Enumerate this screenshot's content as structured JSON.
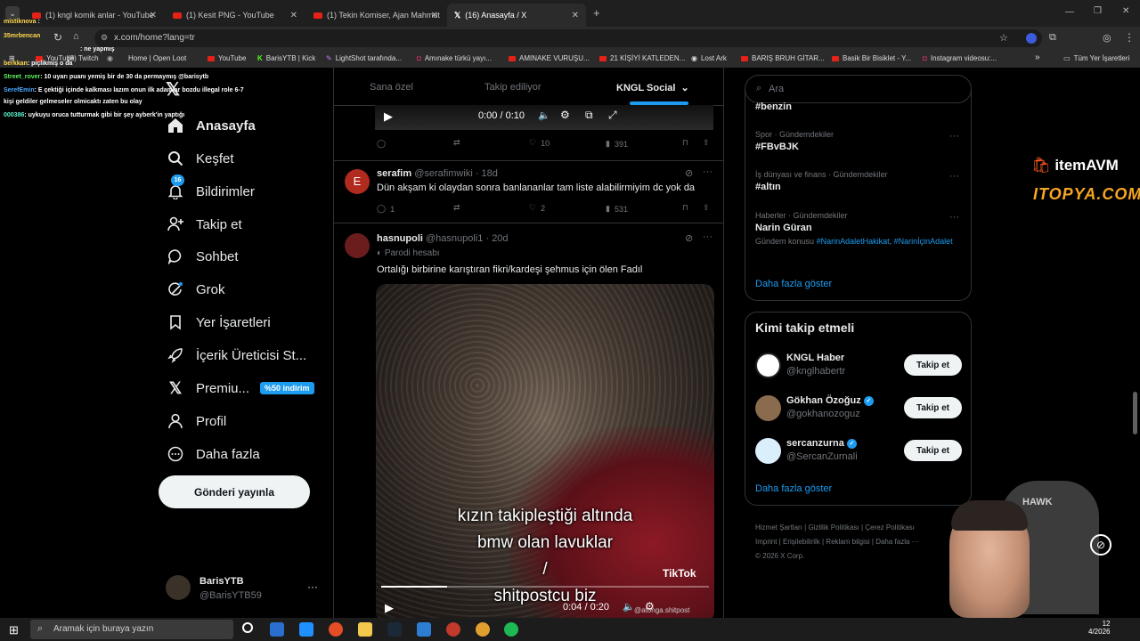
{
  "browser": {
    "tabs": [
      {
        "label": "(1) kngl komik anlar - YouTube"
      },
      {
        "label": "(1) Kesit PNG - YouTube"
      },
      {
        "label": "(1) Tekin Komiser, Ajan Mahmut"
      },
      {
        "label": "(16) Anasayfa / X"
      }
    ],
    "new_tab": "+",
    "url": "x.com/home?lang=tr",
    "bookmarks": [
      "YouTube",
      "(8) Twitch",
      "Home | Open Loot",
      "YouTube",
      "BarisYTB | Kick",
      "LightShot tarafında...",
      "Amınake türkü yayı...",
      "AMINAKE VURUŞU...",
      "21 KİŞİYİ KATLEDEN...",
      "Lost Ark",
      "BARIŞ BRUH GİTAR...",
      "Basik Bir Bisiklet - Y...",
      "Instagram videosu:..."
    ],
    "bookmarks_more": "»",
    "all_bookmarks": "Tüm Yer İşaretleri"
  },
  "nav": {
    "items": [
      {
        "label": "Anasayfa",
        "icon": "home-icon"
      },
      {
        "label": "Keşfet",
        "icon": "search-icon"
      },
      {
        "label": "Bildirimler",
        "icon": "bell-icon",
        "badge": "16"
      },
      {
        "label": "Takip et",
        "icon": "add-person-icon"
      },
      {
        "label": "Sohbet",
        "icon": "chat-icon"
      },
      {
        "label": "Grok",
        "icon": "grok-icon"
      },
      {
        "label": "Yer İşaretleri",
        "icon": "bookmark-icon"
      },
      {
        "label": "İçerik Üreticisi St...",
        "icon": "rocket-icon"
      },
      {
        "label": "Premiu...",
        "icon": "x-logo-icon",
        "badge": "%50 indirim"
      },
      {
        "label": "Profil",
        "icon": "person-icon"
      },
      {
        "label": "Daha fazla",
        "icon": "more-circle-icon"
      }
    ],
    "post_button": "Gönderi yayınla",
    "account": {
      "name": "BarisYTB",
      "handle": "@BarisYTB59",
      "more": "···"
    }
  },
  "feed": {
    "tabs": [
      "Sana özel",
      "Takip ediliyor",
      "KNGL Social"
    ],
    "top_video": {
      "time": "0:00 / 0:10"
    },
    "top_actions": {
      "views": "391",
      "likes": "10"
    },
    "posts": [
      {
        "avatar_letter": "E",
        "name": "serafim",
        "handle": "@serafimwiki",
        "time": "· 18d",
        "text": "Dün akşam ki olaydan sonra banlananlar tam liste alabilirmiyim dc yok da",
        "replies": "1",
        "retweets": "",
        "likes": "2",
        "views": "531"
      },
      {
        "name": "hasnupoli",
        "handle": "@hasnupoli1",
        "time": "· 20d",
        "parody": "Parodi hesabı",
        "text": "Ortalığı birbirine karıştıran fikri/kardeşi şehmus için ölen Fadıl",
        "video_caption": [
          "kızın takipleştiği altında",
          "bmw olan lavuklar",
          "/",
          "shitpostcu biz"
        ],
        "video_time": "0:04 / 0:20",
        "watermark": "TikTok",
        "watermark_handle": "@atonga.shitpost"
      }
    ]
  },
  "sidebar": {
    "search_placeholder": "Ara",
    "trends": [
      {
        "category": "",
        "name": "#benzin"
      },
      {
        "category": "Spor · Gündemdekiler",
        "name": "#FBvBJK"
      },
      {
        "category": "İş dünyası ve finans · Gündemdekiler",
        "name": "#altın"
      },
      {
        "category": "Haberler · Gündemdekiler",
        "name": "Narin Güran",
        "topic_prefix": "Gündem konusu",
        "topics": "#NarinAdaletHakikat, #NarinİçinAdalet"
      }
    ],
    "show_more": "Daha fazla göster",
    "who_to_follow_title": "Kimi takip etmeli",
    "who_to_follow": [
      {
        "name": "KNGL Haber",
        "handle": "@knglhabertr",
        "verified": false
      },
      {
        "name": "Gökhan Özoğuz",
        "handle": "@gokhanozoguz",
        "verified": true
      },
      {
        "name": "sercanzurna",
        "handle": "@SercanZurnali",
        "verified": true
      }
    ],
    "follow_label": "Takip et",
    "show_more_2": "Daha fazla göster",
    "footer": [
      "Hizmet Şartları",
      "Gizlilik Politikası",
      "Çerez Politikası",
      "Imprint",
      "Erişilebilirlik",
      "Reklam bilgisi",
      "Daha fazla ···",
      "© 2026 X Corp."
    ]
  },
  "stream_overlay": {
    "chat": [
      {
        "user": "mistiknova",
        "msg": ""
      },
      {
        "user": "35mrbencan",
        "msg": ""
      },
      {
        "user": "",
        "msg": ": ne yapmış"
      },
      {
        "user": "berkkan",
        "msg": ": piçlikmiş o da"
      },
      {
        "user": "Street_rover",
        "msg": ": 10 uyarı puanı yemiş bir de 30 da permaymış @barisytb"
      },
      {
        "user": "SerefEmin",
        "msg": ": E çektiği içinde kalkması lazım onun ilk adamlar bozdu illegal role 6-7"
      },
      {
        "user": "",
        "msg": "kişi geldiler gelmeseler olmicaktı zaten bu olay"
      },
      {
        "user": "000386",
        "msg": ": uykuyu oruca tutturmak gibi bir şey ayberk'in yaptığı"
      }
    ],
    "sponsor1": "itemAVM",
    "sponsor2": "ITOPYA.COM"
  },
  "taskbar": {
    "search_placeholder": "Aramak için buraya yazın",
    "clock_time": "12",
    "clock_date": "4/2026"
  },
  "colors": {
    "accent": "#1d9bf0",
    "bg": "#000000",
    "border": "#2f3336",
    "muted": "#71767b"
  }
}
